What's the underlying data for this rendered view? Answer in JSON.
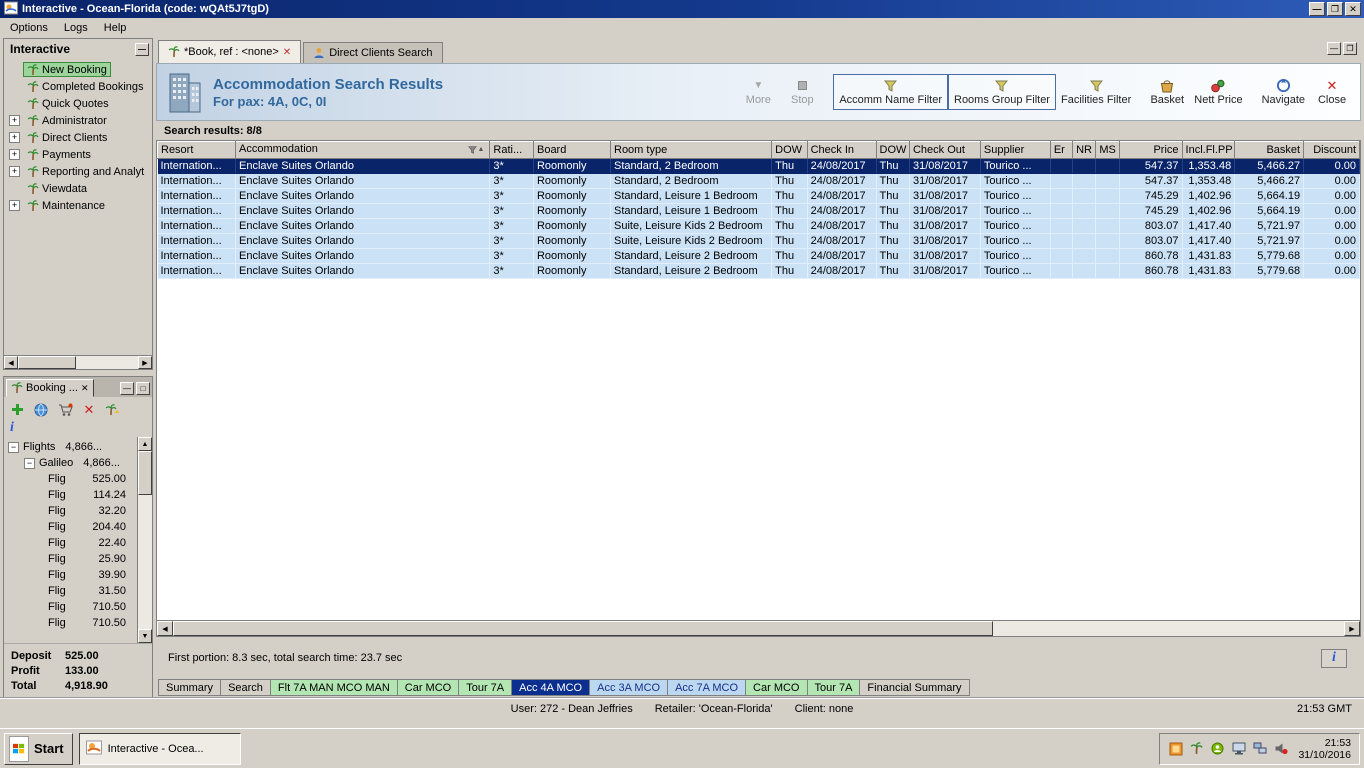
{
  "window": {
    "title": "Interactive - Ocean-Florida (code: wQAt5J7tgD)",
    "menu_items": [
      "Options",
      "Logs",
      "Help"
    ]
  },
  "sidebar": {
    "title": "Interactive",
    "items": [
      {
        "label": "New Booking",
        "selected": true,
        "expandable": false
      },
      {
        "label": "Completed Bookings",
        "selected": false,
        "expandable": false
      },
      {
        "label": "Quick Quotes",
        "selected": false,
        "expandable": false
      },
      {
        "label": "Administrator",
        "selected": false,
        "expandable": true
      },
      {
        "label": "Direct Clients",
        "selected": false,
        "expandable": true
      },
      {
        "label": "Payments",
        "selected": false,
        "expandable": true
      },
      {
        "label": "Reporting and Analyt",
        "selected": false,
        "expandable": true
      },
      {
        "label": "Viewdata",
        "selected": false,
        "expandable": false
      },
      {
        "label": "Maintenance",
        "selected": false,
        "expandable": true
      }
    ]
  },
  "booking_panel": {
    "tab_label": "Booking ...",
    "toolbar_icons": [
      "add-icon",
      "globe-icon",
      "cart-icon",
      "delete-icon",
      "palm-export-icon"
    ],
    "tree": {
      "root_label": "Flights",
      "root_value": "4,866...",
      "group_label": "Galileo",
      "group_value": "4,866...",
      "leaves": [
        {
          "label": "Flig",
          "value": "525.00"
        },
        {
          "label": "Flig",
          "value": "114.24"
        },
        {
          "label": "Flig",
          "value": "32.20"
        },
        {
          "label": "Flig",
          "value": "204.40"
        },
        {
          "label": "Flig",
          "value": "22.40"
        },
        {
          "label": "Flig",
          "value": "25.90"
        },
        {
          "label": "Flig",
          "value": "39.90"
        },
        {
          "label": "Flig",
          "value": "31.50"
        },
        {
          "label": "Flig",
          "value": "710.50"
        },
        {
          "label": "Flig",
          "value": "710.50"
        }
      ]
    },
    "summary": [
      {
        "label": "Deposit",
        "value": "525.00"
      },
      {
        "label": "Profit",
        "value": "133.00"
      },
      {
        "label": "Total",
        "value": "4,918.90"
      }
    ]
  },
  "main": {
    "tabs": [
      {
        "label": "*Book, ref : <none>",
        "active": true
      },
      {
        "label": "Direct Clients Search",
        "active": false
      }
    ],
    "header": {
      "title": "Accommodation Search Results",
      "subtitle": "For pax: 4A, 0C, 0I"
    },
    "toolbar": [
      {
        "label": "More",
        "icon": "more-icon",
        "disabled": true,
        "highlighted": false,
        "group": 0
      },
      {
        "label": "Stop",
        "icon": "stop-icon",
        "disabled": true,
        "highlighted": false,
        "group": 0
      },
      {
        "label": "Accomm Name Filter",
        "icon": "funnel-icon",
        "disabled": false,
        "highlighted": true,
        "group": 1
      },
      {
        "label": "Rooms Group Filter",
        "icon": "funnel-icon",
        "disabled": false,
        "highlighted": true,
        "group": 1
      },
      {
        "label": "Facilities Filter",
        "icon": "funnel-icon",
        "disabled": false,
        "highlighted": false,
        "group": 1
      },
      {
        "label": "Basket",
        "icon": "basket-icon",
        "disabled": false,
        "highlighted": false,
        "group": 2
      },
      {
        "label": "Nett Price",
        "icon": "price-icon",
        "disabled": false,
        "highlighted": false,
        "group": 2
      },
      {
        "label": "Navigate",
        "icon": "navigate-icon",
        "disabled": false,
        "highlighted": false,
        "group": 3
      },
      {
        "label": "Close",
        "icon": "close-icon",
        "disabled": false,
        "highlighted": false,
        "group": 3
      }
    ],
    "results_label": "Search results: 8/8",
    "table": {
      "columns": [
        "Resort",
        "Accommodation",
        "Rati...",
        "Board",
        "Room type",
        "DOW",
        "Check In",
        "DOW",
        "Check Out",
        "Supplier",
        "Er",
        "NR",
        "MS",
        "Price",
        "Incl.Fl.PP",
        "Basket",
        "Discount"
      ],
      "selected_row": 0,
      "rows": [
        [
          "Internation...",
          "Enclave Suites Orlando",
          "3*",
          "Roomonly",
          "Standard, 2 Bedroom",
          "Thu",
          "24/08/2017",
          "Thu",
          "31/08/2017",
          "Tourico ...",
          "",
          "",
          "",
          "547.37",
          "1,353.48",
          "5,466.27",
          "0.00"
        ],
        [
          "Internation...",
          "Enclave Suites Orlando",
          "3*",
          "Roomonly",
          "Standard, 2 Bedroom",
          "Thu",
          "24/08/2017",
          "Thu",
          "31/08/2017",
          "Tourico ...",
          "",
          "",
          "",
          "547.37",
          "1,353.48",
          "5,466.27",
          "0.00"
        ],
        [
          "Internation...",
          "Enclave Suites Orlando",
          "3*",
          "Roomonly",
          "Standard, Leisure 1 Bedroom",
          "Thu",
          "24/08/2017",
          "Thu",
          "31/08/2017",
          "Tourico ...",
          "",
          "",
          "",
          "745.29",
          "1,402.96",
          "5,664.19",
          "0.00"
        ],
        [
          "Internation...",
          "Enclave Suites Orlando",
          "3*",
          "Roomonly",
          "Standard, Leisure 1 Bedroom",
          "Thu",
          "24/08/2017",
          "Thu",
          "31/08/2017",
          "Tourico ...",
          "",
          "",
          "",
          "745.29",
          "1,402.96",
          "5,664.19",
          "0.00"
        ],
        [
          "Internation...",
          "Enclave Suites Orlando",
          "3*",
          "Roomonly",
          "Suite, Leisure Kids 2 Bedroom",
          "Thu",
          "24/08/2017",
          "Thu",
          "31/08/2017",
          "Tourico ...",
          "",
          "",
          "",
          "803.07",
          "1,417.40",
          "5,721.97",
          "0.00"
        ],
        [
          "Internation...",
          "Enclave Suites Orlando",
          "3*",
          "Roomonly",
          "Suite, Leisure Kids 2 Bedroom",
          "Thu",
          "24/08/2017",
          "Thu",
          "31/08/2017",
          "Tourico ...",
          "",
          "",
          "",
          "803.07",
          "1,417.40",
          "5,721.97",
          "0.00"
        ],
        [
          "Internation...",
          "Enclave Suites Orlando",
          "3*",
          "Roomonly",
          "Standard, Leisure 2 Bedroom",
          "Thu",
          "24/08/2017",
          "Thu",
          "31/08/2017",
          "Tourico ...",
          "",
          "",
          "",
          "860.78",
          "1,431.83",
          "5,779.68",
          "0.00"
        ],
        [
          "Internation...",
          "Enclave Suites Orlando",
          "3*",
          "Roomonly",
          "Standard, Leisure 2 Bedroom",
          "Thu",
          "24/08/2017",
          "Thu",
          "31/08/2017",
          "Tourico ...",
          "",
          "",
          "",
          "860.78",
          "1,431.83",
          "5,779.68",
          "0.00"
        ]
      ]
    },
    "status_text": "First portion: 8.3 sec, total search time: 23.7 sec",
    "bottom_tabs": [
      {
        "label": "Summary",
        "style": "plain"
      },
      {
        "label": "Search",
        "style": "plain"
      },
      {
        "label": "Flt 7A MAN MCO MAN",
        "style": "green"
      },
      {
        "label": "Car MCO",
        "style": "green"
      },
      {
        "label": "Tour 7A",
        "style": "green"
      },
      {
        "label": "Acc 4A MCO",
        "style": "selected"
      },
      {
        "label": "Acc 3A MCO",
        "style": "blue"
      },
      {
        "label": "Acc 7A MCO",
        "style": "blue"
      },
      {
        "label": "Car MCO",
        "style": "green"
      },
      {
        "label": "Tour 7A",
        "style": "green"
      },
      {
        "label": "Financial Summary",
        "style": "plain"
      }
    ]
  },
  "statusbar": {
    "user": "User: 272 - Dean Jeffries",
    "retailer": "Retailer: 'Ocean-Florida'",
    "client": "Client: none",
    "time": "21:53 GMT"
  },
  "taskbar": {
    "start_label": "Start",
    "task_label": "Interactive - Ocea...",
    "clock_time": "21:53",
    "clock_date": "31/10/2016",
    "tray_icons": [
      "launcher-icon",
      "palm-tray-icon",
      "chat-icon",
      "display-icon",
      "network-icon",
      "volume-muted-icon"
    ]
  },
  "colors": {
    "titlebar_blue": "#0a246a",
    "selection_navy": "#0a246a",
    "grid_row_blue": "#cbe2f6",
    "sidebar_selected_green": "#9cd49c",
    "tab_green": "#b4e6b4",
    "tab_light_blue": "#bcd8f0",
    "tab_selected_blue": "#0b2f8f",
    "header_text_blue": "#31699e"
  }
}
